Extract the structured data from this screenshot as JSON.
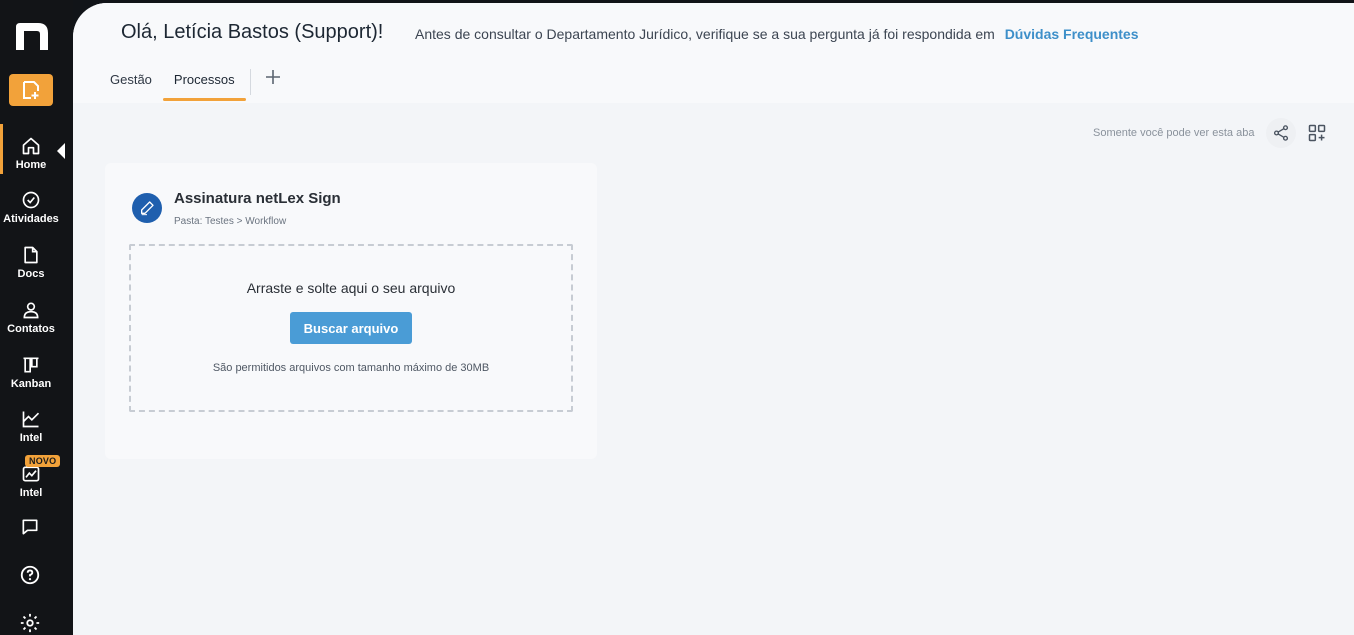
{
  "sidebar": {
    "logo": "n",
    "items": [
      {
        "label": "Home",
        "icon": "home-icon"
      },
      {
        "label": "Atividades",
        "icon": "check-circle-icon"
      },
      {
        "label": "Docs",
        "icon": "document-icon"
      },
      {
        "label": "Contatos",
        "icon": "user-icon"
      },
      {
        "label": "Kanban",
        "icon": "kanban-icon"
      },
      {
        "label": "Intel",
        "icon": "chart-line-icon"
      },
      {
        "label": "Intel",
        "icon": "chart-box-icon"
      }
    ],
    "badge": "NOVO",
    "accent_color": "#f2a23a"
  },
  "header": {
    "greeting": "Olá, Letícia Bastos (Support)!",
    "notice": "Antes de consultar o Departamento Jurídico, verifique se a sua pergunta já foi respondida em",
    "notice_link": "Dúvidas Frequentes"
  },
  "tabs": [
    {
      "label": "Gestão",
      "active": false
    },
    {
      "label": "Processos",
      "active": true
    }
  ],
  "toolbar": {
    "visibility_note": "Somente você pode ver esta aba"
  },
  "card": {
    "title": "Assinatura netLex Sign",
    "path": "Pasta: Testes > Workflow",
    "drop_text": "Arraste e solte aqui o seu arquivo",
    "browse_label": "Buscar arquivo",
    "size_note": "São permitidos arquivos com tamanho máximo de 30MB"
  }
}
